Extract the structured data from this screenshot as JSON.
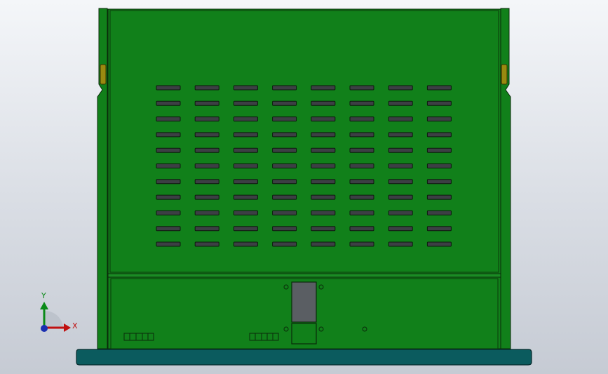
{
  "viewport": {
    "background_top": "#f4f6f9",
    "background_bottom": "#c6cbd4"
  },
  "model": {
    "body_color": "#11801a",
    "edge_color": "#0a2a0a",
    "slot_color": "#3c3f44",
    "base_color": "#0b5b5e",
    "hinge_color": "#9a8a10",
    "window_color": "#5a5e63",
    "vent_rows": 11,
    "vent_cols": 8
  },
  "triad": {
    "y_label": "Y",
    "x_label": "X",
    "y_color": "#0a8a18",
    "x_color": "#c01010",
    "origin_color": "#1a2fb0"
  }
}
